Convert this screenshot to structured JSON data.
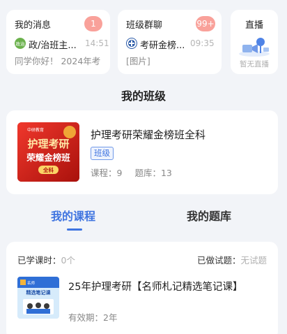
{
  "messages": {
    "title": "我的消息",
    "badge": "1",
    "avatar_text": "政治",
    "sender": "政/治班主...",
    "time": "14:51",
    "preview": "同学你好！ 2024年考"
  },
  "group_chat": {
    "title": "班级群聊",
    "badge": "99+",
    "group_name": "考研金榜...",
    "time": "09:35",
    "preview": "[图片]"
  },
  "live": {
    "title": "直播",
    "subtitle": "暂无直播"
  },
  "my_class": {
    "section_title": "我的班级",
    "name": "护理考研荣耀金榜班全科",
    "tag": "班级",
    "course_label": "课程：",
    "course_count": "9",
    "bank_label": "题库：",
    "bank_count": "13",
    "cover": {
      "brand": "中研教育",
      "line1": "护理考研",
      "line2": "荣耀金榜班",
      "line3": "全科"
    }
  },
  "tabs": [
    {
      "label": "我的课程",
      "active": true
    },
    {
      "label": "我的题库",
      "active": false
    }
  ],
  "course_card": {
    "studied_label": "已学课时：",
    "studied_value": "0个",
    "done_label": "已做试题：",
    "done_value": "无试题",
    "course_name": "25年护理考研【名师札记精选笔记课】",
    "validity_label": "有效期：",
    "validity_value": "2年",
    "cover": {
      "line1": "名师",
      "line2": "精选笔记课"
    }
  },
  "colors": {
    "accent": "#3f74e0",
    "badge": "#f9a19a",
    "background": "#f2f4f8"
  }
}
